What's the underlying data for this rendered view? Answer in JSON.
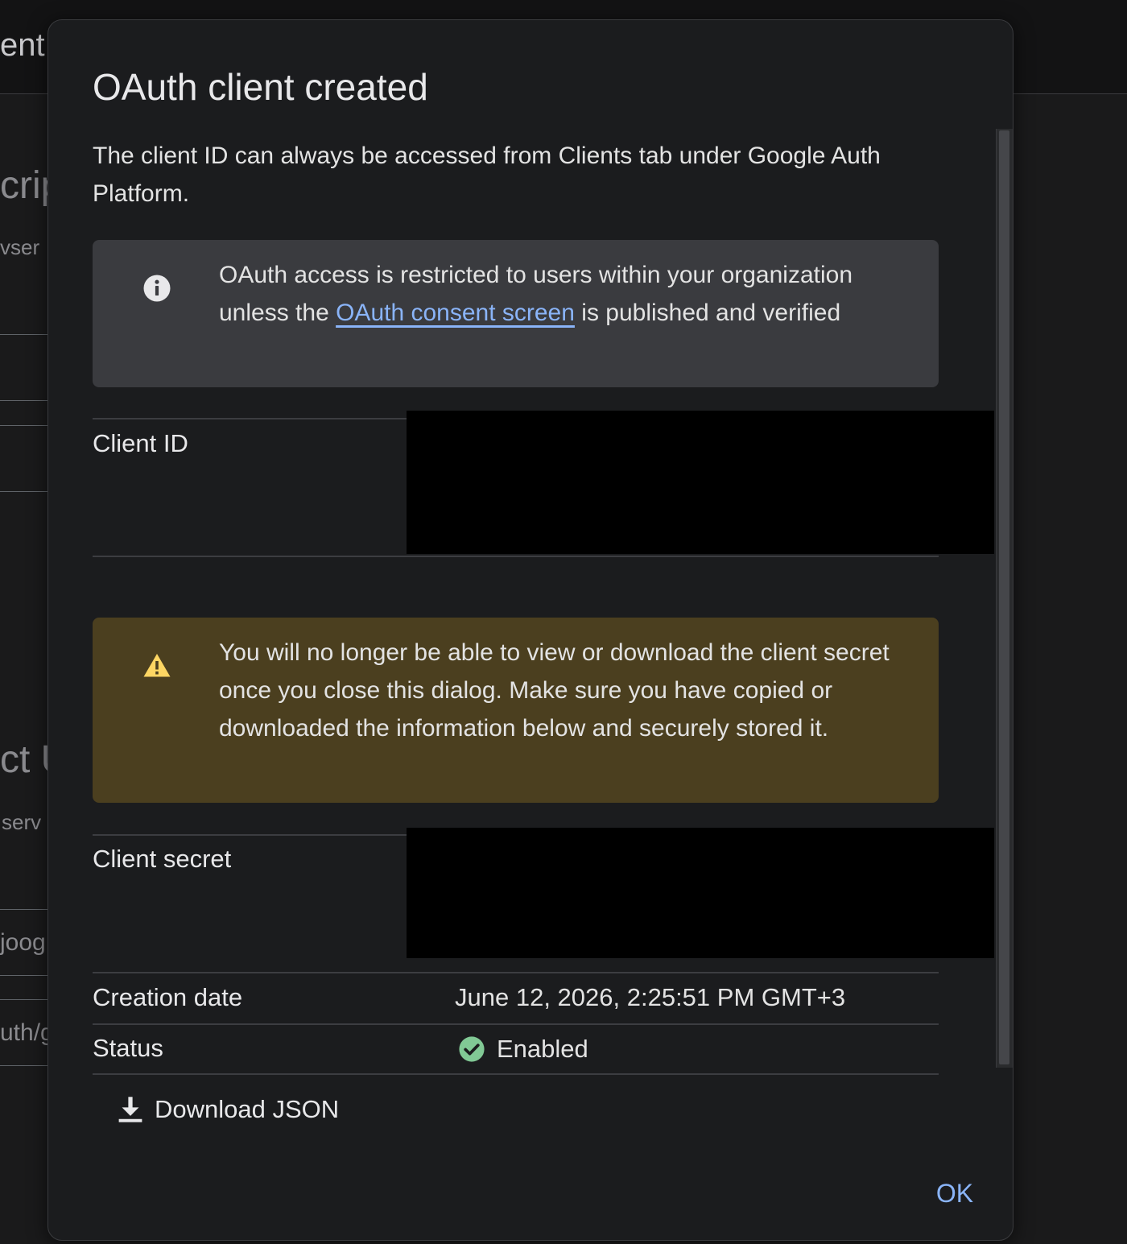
{
  "background": {
    "fragments": [
      "ent",
      "crip",
      "vser",
      "ct U",
      "serv",
      "joog",
      "uth/g"
    ]
  },
  "dialog": {
    "title": "OAuth client created",
    "subtitle": "The client ID can always be accessed from Clients tab under Google Auth Platform.",
    "info_banner": {
      "icon": "info-icon",
      "text_before": "OAuth access is restricted to users within your organization unless the ",
      "link_text": "OAuth consent screen",
      "text_after": " is published and verified"
    },
    "client_id": {
      "label": "Client ID",
      "value_redacted": true
    },
    "warning_banner": {
      "icon": "warning-icon",
      "text": "You will no longer be able to view or download the client secret once you close this dialog. Make sure you have copied or downloaded the information below and securely stored it."
    },
    "client_secret": {
      "label": "Client secret",
      "value_redacted": true
    },
    "creation_date": {
      "label": "Creation date",
      "value": "June 12, 2026, 2:25:51 PM GMT+3"
    },
    "status": {
      "label": "Status",
      "value": "Enabled",
      "icon": "check-circle-icon",
      "color": "#81c995"
    },
    "download_button": {
      "label": "Download JSON",
      "icon": "download-icon"
    },
    "ok_button": {
      "label": "OK"
    }
  },
  "colors": {
    "link": "#8ab4f8",
    "warning_icon": "#fdd663",
    "warning_bg": "#4b3f1f",
    "info_bg": "#3a3b3f"
  }
}
